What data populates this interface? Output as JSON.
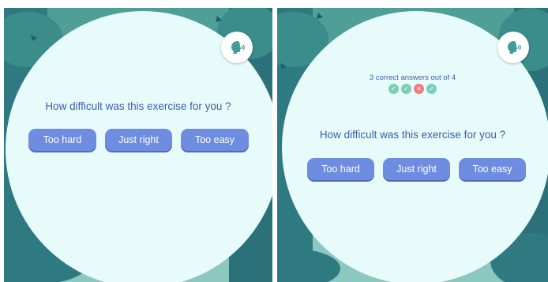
{
  "colors": {
    "circle_bg": "#e8fbfb",
    "text_blue": "#3a5ea8",
    "button_bg": "#6e8de0",
    "button_shadow": "#4f6bbd",
    "correct_green": "#7ccfb6",
    "wrong_red": "#ef7b7b",
    "voice_icon": "#3f9e9b"
  },
  "left_panel": {
    "voice_icon": "speaking-head-icon",
    "question": "How difficult was this exercise for you ?",
    "buttons": [
      "Too hard",
      "Just right",
      "Too easy"
    ]
  },
  "right_panel": {
    "voice_icon": "speaking-head-icon",
    "score_text": "3 correct answers out of 4",
    "results": [
      "correct",
      "correct",
      "wrong",
      "correct"
    ],
    "question": "How difficult was this exercise for you ?",
    "buttons": [
      "Too hard",
      "Just right",
      "Too easy"
    ]
  }
}
